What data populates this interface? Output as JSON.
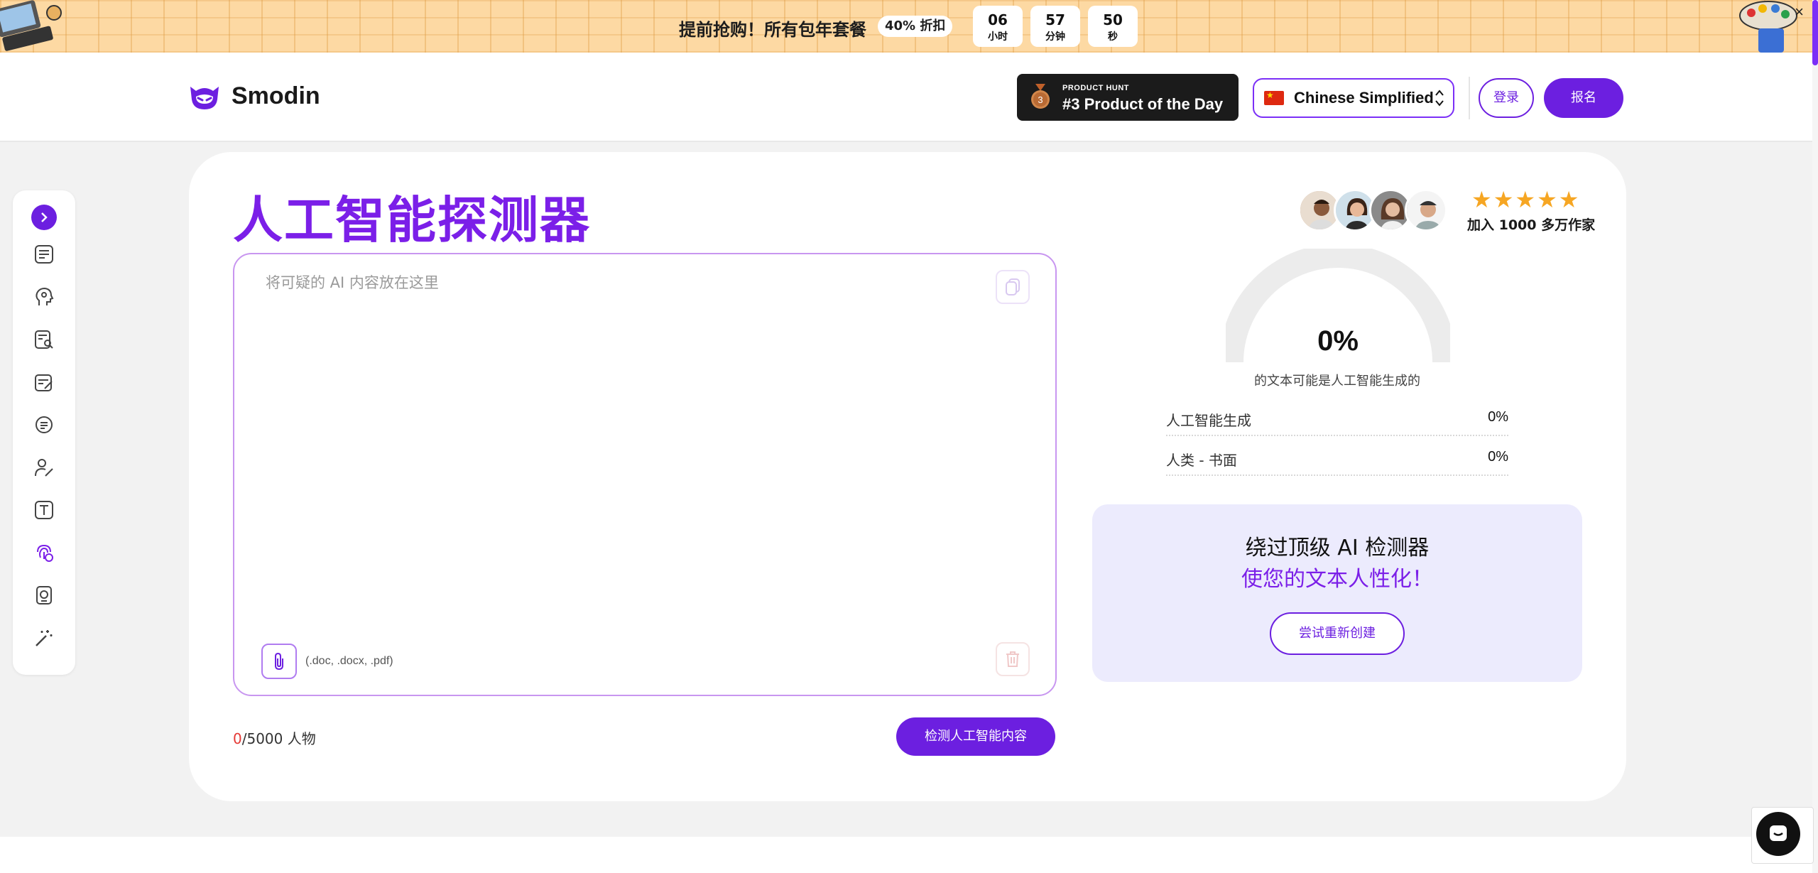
{
  "promo": {
    "text": "提前抢购！所有包年套餐",
    "badge": "40% 折扣",
    "timer": [
      {
        "num": "06",
        "unit": "小时"
      },
      {
        "num": "57",
        "unit": "分钟"
      },
      {
        "num": "50",
        "unit": "秒"
      }
    ],
    "close": "×"
  },
  "header": {
    "logo": "Smodin",
    "product_hunt": {
      "rank": "3",
      "small": "PRODUCT HUNT",
      "big": "#3 Product of the Day"
    },
    "language": "Chinese Simplified",
    "login": "登录",
    "signup": "报名"
  },
  "sidebar": {
    "items": [
      "expand",
      "document",
      "head",
      "search-doc",
      "edit-doc",
      "chat",
      "person-pen",
      "text",
      "fingerprint",
      "badge",
      "magic"
    ]
  },
  "main": {
    "title": "人工智能探测器",
    "editor": {
      "placeholder": "将可疑的 AI 内容放在这里",
      "file_types": "(.doc, .docx, .pdf)"
    },
    "count": {
      "current": "0",
      "rest": "/5000 人物"
    },
    "detect_button": "检测人工智能内容"
  },
  "results": {
    "stars": "★★★★★",
    "join": "加入 1000 多万作家",
    "gauge_value": 0,
    "percent": "0%",
    "caption": "的文本可能是人工智能生成的",
    "stats": [
      {
        "label": "人工智能生成",
        "value": "0%"
      },
      {
        "label": "人类 - 书面",
        "value": "0%"
      }
    ]
  },
  "humanize": {
    "title": "绕过顶级 AI 检测器",
    "subtitle": "使您的文本人性化！",
    "button": "尝试重新创建"
  },
  "colors": {
    "accent": "#6c1fe0",
    "title": "#7b1fe8",
    "promo_bg": "#fdd9a3",
    "star": "#f6a623"
  }
}
